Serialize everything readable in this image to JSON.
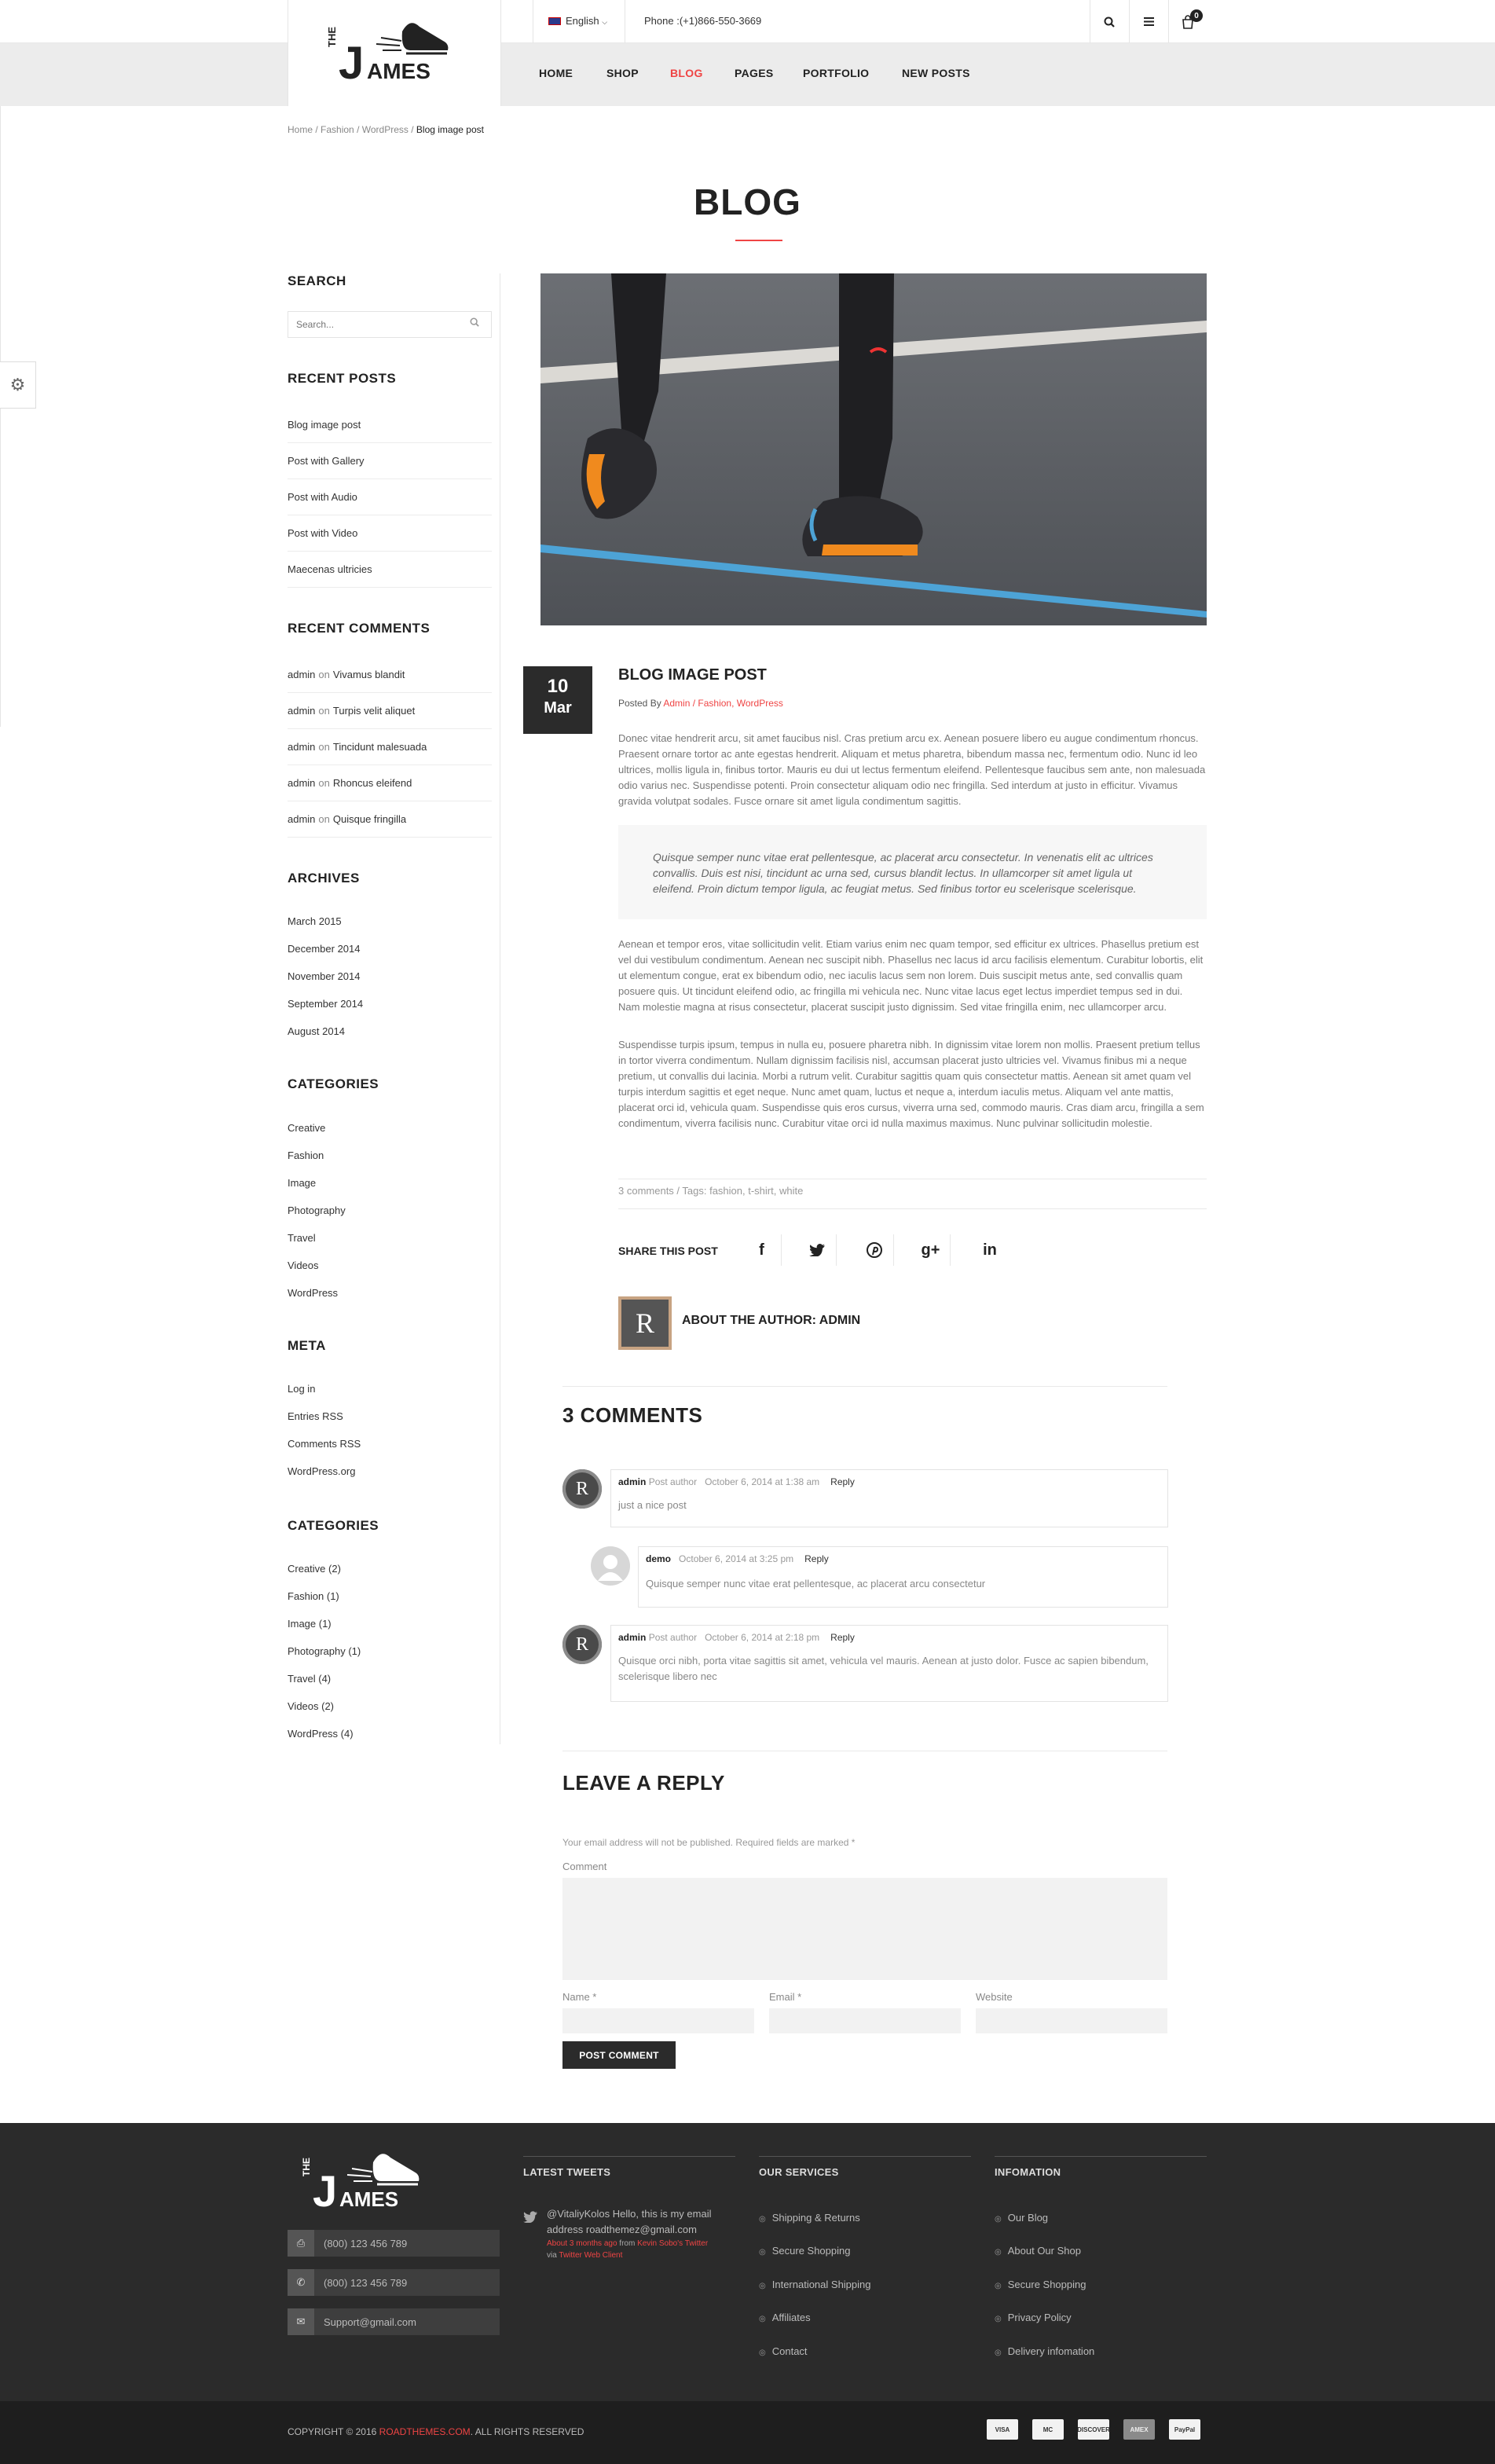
{
  "header": {
    "language": "English",
    "phone": "Phone :(+1)866-550-3669",
    "cart_count": "0",
    "nav": [
      "HOME",
      "SHOP",
      "BLOG",
      "PAGES",
      "PORTFOLIO",
      "NEW POSTS"
    ],
    "active_nav": "BLOG",
    "accent": "#ef4444"
  },
  "logo": {
    "the": "THE",
    "j": "J",
    "ames": "AMES"
  },
  "breadcrumb": {
    "items": [
      "Home",
      "Fashion",
      "WordPress"
    ],
    "current": "Blog image post"
  },
  "page_title": "BLOG",
  "sidebar": {
    "search_title": "SEARCH",
    "search_placeholder": "Search...",
    "recent_posts_title": "RECENT POSTS",
    "recent_posts": [
      "Blog image post",
      "Post with Gallery",
      "Post with Audio",
      "Post with Video",
      "Maecenas ultricies"
    ],
    "recent_comments_title": "RECENT COMMENTS",
    "recent_comments": [
      {
        "author": "admin",
        "on": "on",
        "post": "Vivamus blandit"
      },
      {
        "author": "admin",
        "on": "on",
        "post": "Turpis velit aliquet"
      },
      {
        "author": "admin",
        "on": "on",
        "post": "Tincidunt malesuada"
      },
      {
        "author": "admin",
        "on": "on",
        "post": "Rhoncus eleifend"
      },
      {
        "author": "admin",
        "on": "on",
        "post": "Quisque fringilla"
      }
    ],
    "archives_title": "ARCHIVES",
    "archives": [
      "March 2015",
      "December 2014",
      "November 2014",
      "September 2014",
      "August 2014"
    ],
    "categories_title": "CATEGORIES",
    "categories": [
      "Creative",
      "Fashion",
      "Image",
      "Photography",
      "Travel",
      "Videos",
      "WordPress"
    ],
    "meta_title": "META",
    "meta": [
      "Log in",
      "Entries RSS",
      "Comments RSS",
      "WordPress.org"
    ],
    "categories2_title": "CATEGORIES",
    "categories2": [
      "Creative (2)",
      "Fashion (1)",
      "Image (1)",
      "Photography (1)",
      "Travel (4)",
      "Videos (2)",
      "WordPress (4)"
    ]
  },
  "post": {
    "day": "10",
    "month": "Mar",
    "title": "BLOG IMAGE POST",
    "posted_by": "Posted By",
    "meta_links": "Admin / Fashion, WordPress",
    "para1": "Donec vitae hendrerit arcu, sit amet faucibus nisl. Cras pretium arcu ex. Aenean posuere libero eu augue condimentum rhoncus. Praesent ornare tortor ac ante egestas hendrerit. Aliquam et metus pharetra, bibendum massa nec, fermentum odio. Nunc id leo ultrices, mollis ligula in, finibus tortor. Mauris eu dui ut lectus fermentum eleifend. Pellentesque faucibus sem ante, non malesuada odio varius nec. Suspendisse potenti. Proin consectetur aliquam odio nec fringilla. Sed interdum at justo in efficitur. Vivamus gravida volutpat sodales. Fusce ornare sit amet ligula condimentum sagittis.",
    "quote": "Quisque semper nunc vitae erat pellentesque, ac placerat arcu consectetur. In venenatis elit ac ultrices convallis. Duis est nisi, tincidunt ac urna sed, cursus blandit lectus. In ullamcorper sit amet ligula ut eleifend. Proin dictum tempor ligula, ac feugiat metus. Sed finibus tortor eu scelerisque scelerisque.",
    "para2": "Aenean et tempor eros, vitae sollicitudin velit. Etiam varius enim nec quam tempor, sed efficitur ex ultrices. Phasellus pretium est vel dui vestibulum condimentum. Aenean nec suscipit nibh. Phasellus nec lacus id arcu facilisis elementum. Curabitur lobortis, elit ut elementum congue, erat ex bibendum odio, nec iaculis lacus sem non lorem. Duis suscipit metus ante, sed convallis quam posuere quis. Ut tincidunt eleifend odio, ac fringilla mi vehicula nec. Nunc vitae lacus eget lectus imperdiet tempus sed in dui. Nam molestie magna at risus consectetur, placerat suscipit justo dignissim. Sed vitae fringilla enim, nec ullamcorper arcu.",
    "para3": "Suspendisse turpis ipsum, tempus in nulla eu, posuere pharetra nibh. In dignissim vitae lorem non mollis. Praesent pretium tellus in tortor viverra condimentum. Nullam dignissim facilisis nisl, accumsan placerat justo ultricies vel. Vivamus finibus mi a neque pretium, ut convallis dui lacinia. Morbi a rutrum velit. Curabitur sagittis quam quis consectetur mattis. Aenean sit amet quam vel turpis interdum sagittis et eget neque. Nunc amet quam, luctus et neque a, interdum iaculis metus. Aliquam vel ante mattis, placerat orci id, vehicula quam. Suspendisse quis eros cursus, viverra urna sed, commodo mauris. Cras diam arcu, fringilla a sem condimentum, viverra facilisis nunc. Curabitur vitae orci id nulla maximus maximus. Nunc pulvinar sollicitudin molestie.",
    "tags": "3 comments / Tags: fashion, t-shirt, white",
    "share_label": "SHARE THIS POST",
    "about_author": "ABOUT THE AUTHOR: ADMIN",
    "avatar_letter": "R"
  },
  "comments": {
    "title": "3 COMMENTS",
    "items": [
      {
        "author": "admin",
        "role": "Post author",
        "date": "October 6, 2014 at 1:38 am",
        "reply": "Reply",
        "text": "just a nice post",
        "avatar": "R"
      },
      {
        "author": "demo",
        "role": "",
        "date": "October 6, 2014 at 3:25 pm",
        "reply": "Reply",
        "text": "Quisque semper nunc vitae erat pellentesque, ac placerat arcu consectetur",
        "avatar": ""
      },
      {
        "author": "admin",
        "role": "Post author",
        "date": "October 6, 2014 at 2:18 pm",
        "reply": "Reply",
        "text": "Quisque orci nibh, porta vitae sagittis sit amet, vehicula vel mauris. Aenean at justo dolor. Fusce ac sapien bibendum, scelerisque libero nec",
        "avatar": "R"
      }
    ]
  },
  "reply": {
    "title": "LEAVE A REPLY",
    "note": "Your email address will not be published. Required fields are marked *",
    "comment_label": "Comment",
    "name_label": "Name *",
    "email_label": "Email *",
    "website_label": "Website",
    "submit": "POST COMMENT"
  },
  "footer": {
    "contacts": [
      "(800) 123 456 789",
      "(800) 123 456 789",
      "Support@gmail.com"
    ],
    "tweets_title": "LATEST TWEETS",
    "tweet_text": "@VitaliyKolos Hello, this is my email address roadthemez@gmail.com",
    "tweet_time": "About 3 months ago",
    "tweet_from": "from",
    "tweet_source": "Kevin Sobo's Twitter",
    "tweet_via": "via",
    "tweet_client": "Twitter Web Client",
    "services_title": "OUR SERVICES",
    "services": [
      "Shipping & Returns",
      "Secure Shopping",
      "International Shipping",
      "Affiliates",
      "Contact"
    ],
    "info_title": "INFOMATION",
    "info": [
      "Our Blog",
      "About Our Shop",
      "Secure Shopping",
      "Privacy Policy",
      "Delivery infomation"
    ],
    "copyright_pre": "COPYRIGHT © 2016",
    "copyright_link": "ROADTHEMES.COM",
    "copyright_post": ". ALL RIGHTS RESERVED",
    "payments": [
      "VISA",
      "MC",
      "DISCOVER",
      "AMEX",
      "PayPal"
    ]
  }
}
